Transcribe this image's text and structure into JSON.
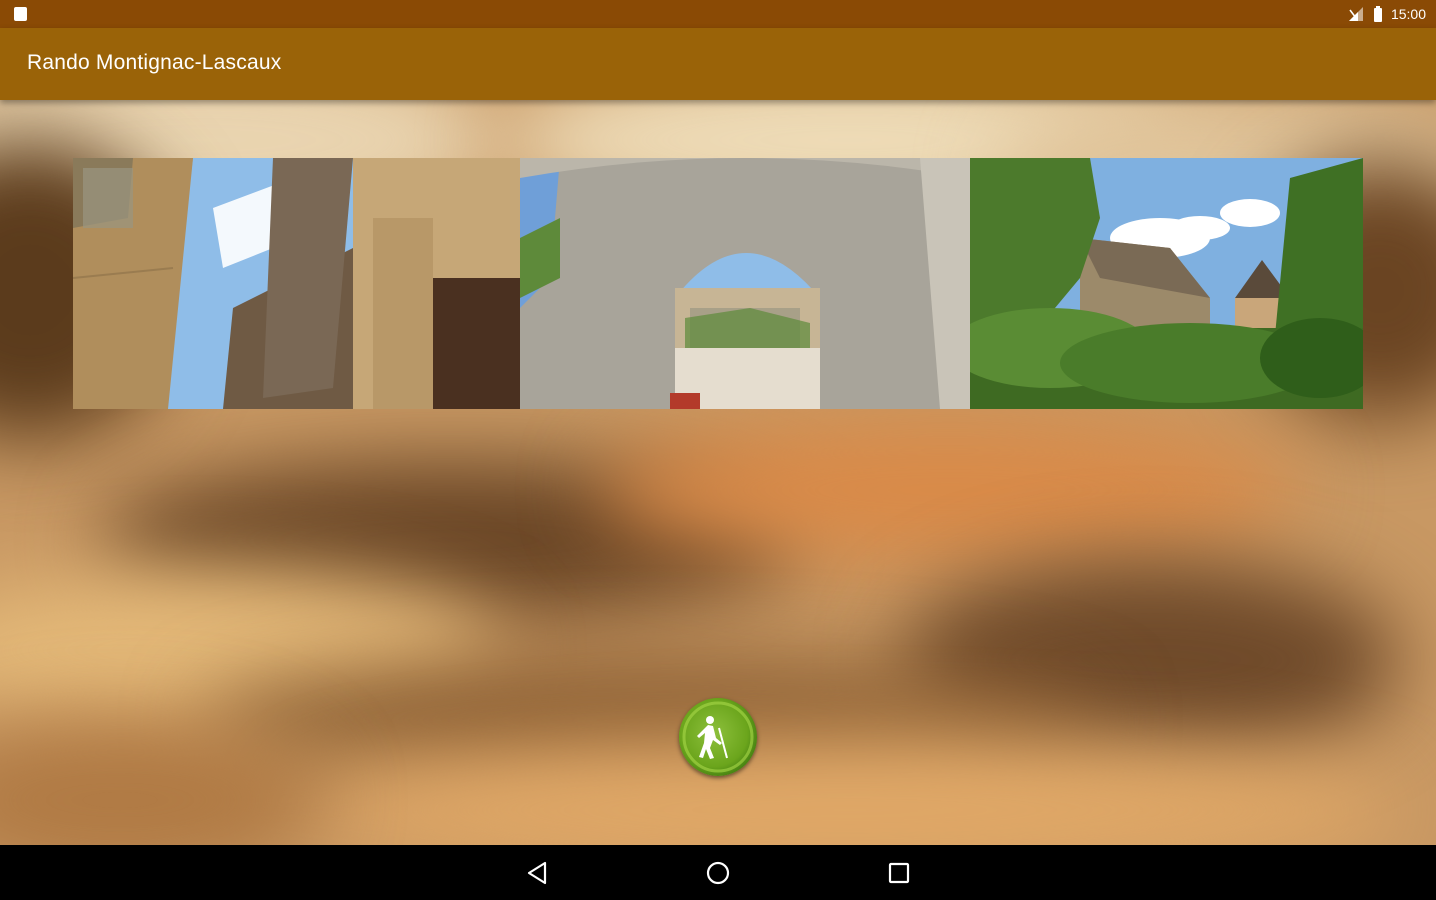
{
  "status_bar": {
    "time": "15:00",
    "left_icon": "sd-card-icon",
    "right_icons": [
      "signal-icon",
      "battery-icon"
    ]
  },
  "app_bar": {
    "title": "Rando Montignac-Lascaux",
    "color": "#9a6308"
  },
  "photos": [
    {
      "name": "medieval-street-photo"
    },
    {
      "name": "stone-archway-photo"
    },
    {
      "name": "castle-greenery-photo"
    }
  ],
  "fab": {
    "icon": "hiker-icon",
    "color": "#6ba51c"
  },
  "nav_bar": {
    "buttons": [
      "back-icon",
      "home-icon",
      "recents-icon"
    ]
  }
}
